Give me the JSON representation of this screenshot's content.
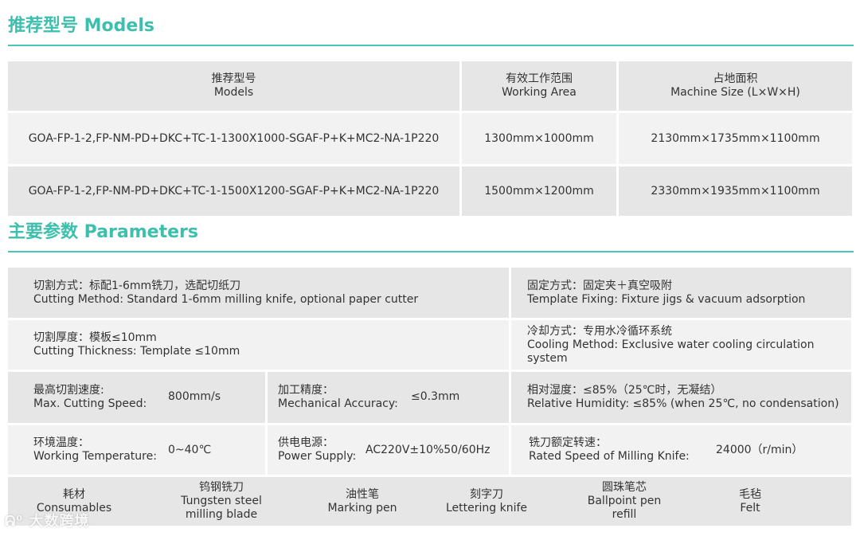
{
  "models_heading": "推荐型号 Models",
  "models_table": {
    "headers": [
      {
        "cn": "推荐型号",
        "en": "Models"
      },
      {
        "cn": "有效工作范围",
        "en": "Working Area"
      },
      {
        "cn": "占地面积",
        "en": "Machine Size (L×W×H)"
      }
    ],
    "rows": [
      {
        "model": "GOA-FP-1-2,FP-NM-PD+DKC+TC-1-1300X1000-SGAF-P+K+MC2-NA-1P220",
        "area": "1300mm×1000mm",
        "size": "2130mm×1735mm×1100mm"
      },
      {
        "model": "GOA-FP-1-2,FP-NM-PD+DKC+TC-1-1500X1200-SGAF-P+K+MC2-NA-1P220",
        "area": "1500mm×1200mm",
        "size": "2330mm×1935mm×1100mm"
      }
    ]
  },
  "params_heading": "主要参数 Parameters",
  "params": {
    "cutting_method": {
      "cn": "切割方式：标配1-6mm铣刀，选配切纸刀",
      "en": "Cutting Method: Standard 1-6mm milling knife, optional paper cutter"
    },
    "template_fixing": {
      "cn": "固定方式：固定夹＋真空吸附",
      "en": "Template Fixing: Fixture jigs & vacuum adsorption"
    },
    "cutting_thickness": {
      "cn": "切割厚度：模板≤10mm",
      "en": "Cutting Thickness: Template ≤10mm"
    },
    "cooling_method": {
      "cn": "冷却方式：专用水冷循环系统",
      "en": "Cooling Method: Exclusive water cooling circulation system"
    },
    "max_speed": {
      "cn": "最高切割速度:",
      "en": "Max. Cutting Speed:",
      "value": "800mm/s"
    },
    "accuracy": {
      "cn": "加工精度：",
      "en": "Mechanical Accuracy:",
      "value": "≤0.3mm"
    },
    "humidity": {
      "cn": "相对湿度：≤85%（25℃时，无凝结）",
      "en": "Relative Humidity: ≤85% (when 25℃, no condensation)"
    },
    "temperature": {
      "cn": "环境温度：",
      "en": "Working Temperature:",
      "value": "0~40℃"
    },
    "power": {
      "cn": "供电电源：",
      "en": "Power Supply:",
      "value": "AC220V±10%50/60Hz"
    },
    "knife_speed": {
      "cn": "铣刀额定转速：",
      "en": "Rated Speed of Milling Knife:",
      "value": "24000（r/min）"
    }
  },
  "consumables": [
    {
      "cn": "耗材",
      "en": "Consumables"
    },
    {
      "cn": "钨钢铣刀",
      "en": "Tungsten steel milling blade"
    },
    {
      "cn": "油性笔",
      "en": "Marking pen"
    },
    {
      "cn": "刻字刀",
      "en": "Lettering knife"
    },
    {
      "cn": "圆珠笔芯",
      "en": "Ballpoint pen refill"
    },
    {
      "cn": "毛毡",
      "en": "Felt"
    }
  ],
  "watermark": "大数跨境",
  "colors": {
    "accent": "#3dbfae",
    "cell": "#e6e6e6",
    "cell_light": "#f2f2f2"
  }
}
